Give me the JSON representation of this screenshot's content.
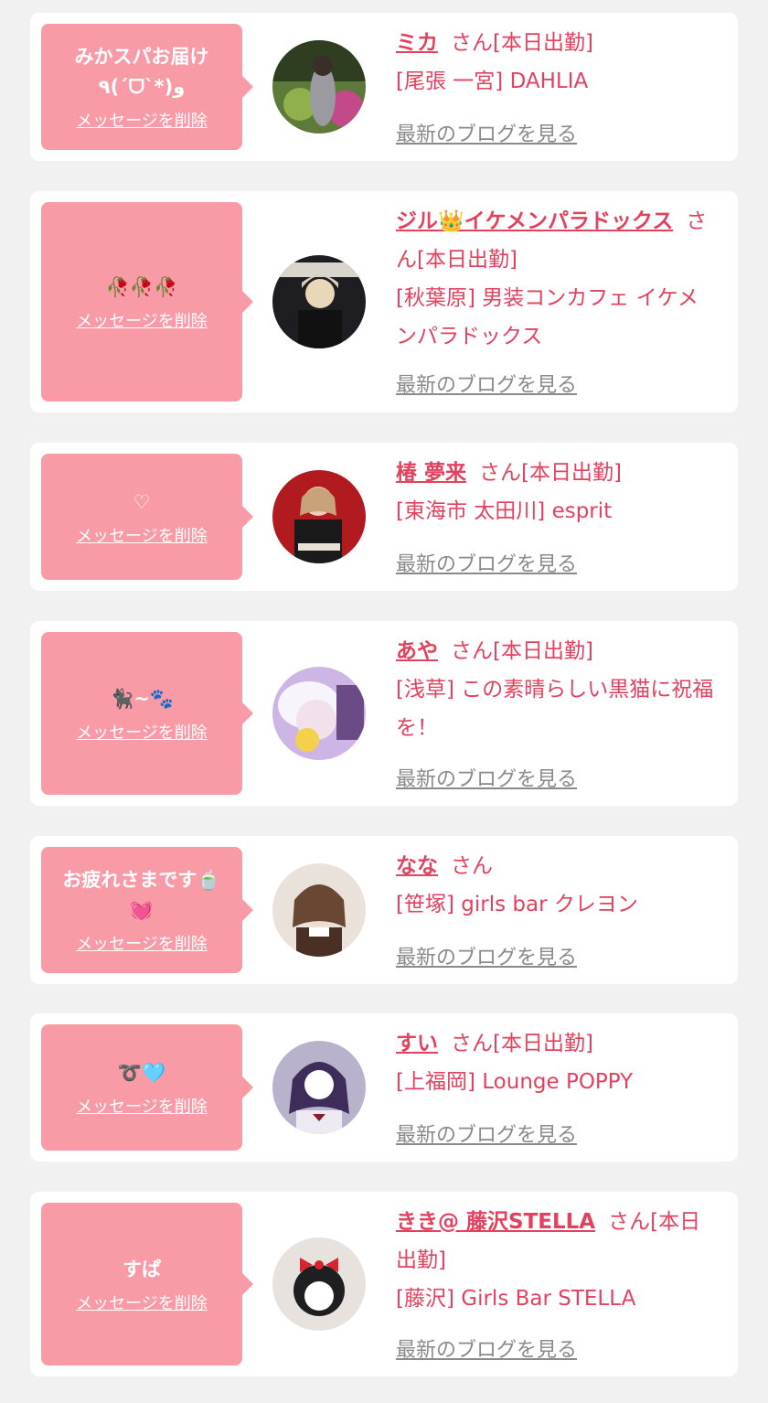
{
  "delete_label": "メッセージを削除",
  "blog_label": "最新のブログを見る",
  "colors": {
    "bubble": "#f99aa7",
    "accent": "#e2425e",
    "muted": "#8a8a8a",
    "card": "#ffffff",
    "bg": "#f1f1f1"
  },
  "items": [
    {
      "message": "みかスパお届け\n٩(ˊᗜˋ*)و",
      "name": "ミカ",
      "status": "さん[本日出勤]",
      "shop": "[尾張 一宮] DAHLIA"
    },
    {
      "message": "🥀🥀🥀",
      "name": "ジル👑イケメンパラドックス",
      "status": "さん[本日出勤]",
      "shop": "[秋葉原] 男装コンカフェ イケメンパラドックス"
    },
    {
      "message": "♡",
      "name": "椿 夢来",
      "status": "さん[本日出勤]",
      "shop": "[東海市 太田川] esprit"
    },
    {
      "message": "🐈‍⬛~🐾",
      "name": "あや",
      "status": "さん[本日出勤]",
      "shop": "[浅草] この素晴らしい黒猫に祝福を！"
    },
    {
      "message": "お疲れさまです🍵\n💓",
      "name": "なな",
      "status": "さん",
      "shop": "[笹塚] girls bar クレヨン"
    },
    {
      "message": "➰🩵",
      "name": "すい",
      "status": "さん[本日出勤]",
      "shop": "[上福岡] Lounge POPPY"
    },
    {
      "message": "すぱ",
      "name": "きき@ 藤沢STELLA",
      "status": "さん[本日出勤]",
      "shop": "[藤沢] Girls Bar STELLA"
    }
  ]
}
